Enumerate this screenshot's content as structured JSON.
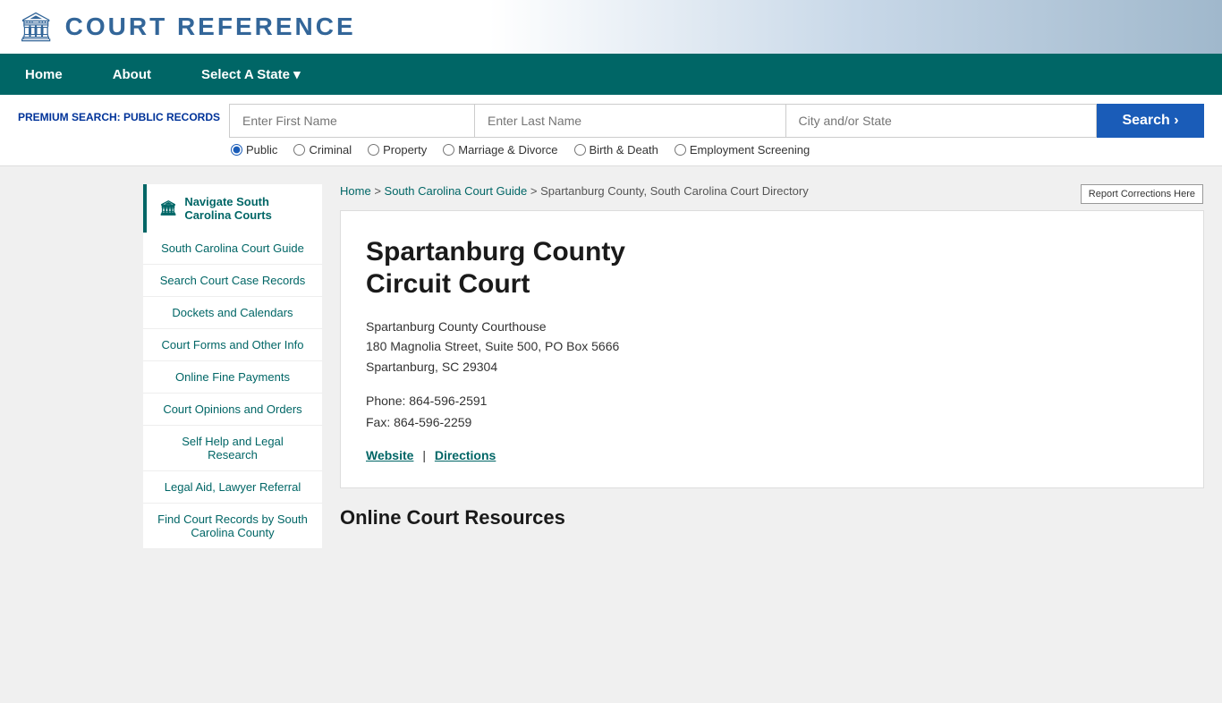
{
  "header": {
    "logo_icon": "🏛",
    "logo_text": "COURT  REFERENCE",
    "header_bg": "#fff"
  },
  "nav": {
    "items": [
      {
        "label": "Home",
        "id": "home"
      },
      {
        "label": "About",
        "id": "about"
      },
      {
        "label": "Select A State ▾",
        "id": "select-state"
      }
    ]
  },
  "search_bar": {
    "premium_label": "PREMIUM SEARCH: PUBLIC RECORDS",
    "first_name_placeholder": "Enter First Name",
    "last_name_placeholder": "Enter Last Name",
    "city_placeholder": "City and/or State",
    "search_button_label": "Search  ›",
    "radio_options": [
      {
        "label": "Public",
        "checked": true
      },
      {
        "label": "Criminal",
        "checked": false
      },
      {
        "label": "Property",
        "checked": false
      },
      {
        "label": "Marriage & Divorce",
        "checked": false
      },
      {
        "label": "Birth & Death",
        "checked": false
      },
      {
        "label": "Employment Screening",
        "checked": false
      }
    ]
  },
  "breadcrumb": {
    "home_label": "Home",
    "sc_guide_label": "South Carolina Court Guide",
    "current": "Spartanburg County, South Carolina Court Directory"
  },
  "sidebar": {
    "header_label": "Navigate South Carolina Courts",
    "items": [
      {
        "label": "South Carolina Court Guide"
      },
      {
        "label": "Search Court Case Records"
      },
      {
        "label": "Dockets and Calendars"
      },
      {
        "label": "Court Forms and Other Info"
      },
      {
        "label": "Online Fine Payments"
      },
      {
        "label": "Court Opinions and Orders"
      },
      {
        "label": "Self Help and Legal Research"
      },
      {
        "label": "Legal Aid, Lawyer Referral"
      },
      {
        "label": "Find Court Records by South Carolina County"
      }
    ]
  },
  "court": {
    "title_line1": "Spartanburg County",
    "title_line2": "Circuit Court",
    "building_name": "Spartanburg County Courthouse",
    "address_line1": "180 Magnolia Street, Suite 500, PO Box 5666",
    "address_line2": "Spartanburg, SC 29304",
    "phone": "Phone: 864-596-2591",
    "fax": "Fax: 864-596-2259",
    "website_label": "Website",
    "directions_label": "Directions"
  },
  "online_resources": {
    "title": "Online Court Resources"
  },
  "report_corrections_label": "Report Corrections Here"
}
